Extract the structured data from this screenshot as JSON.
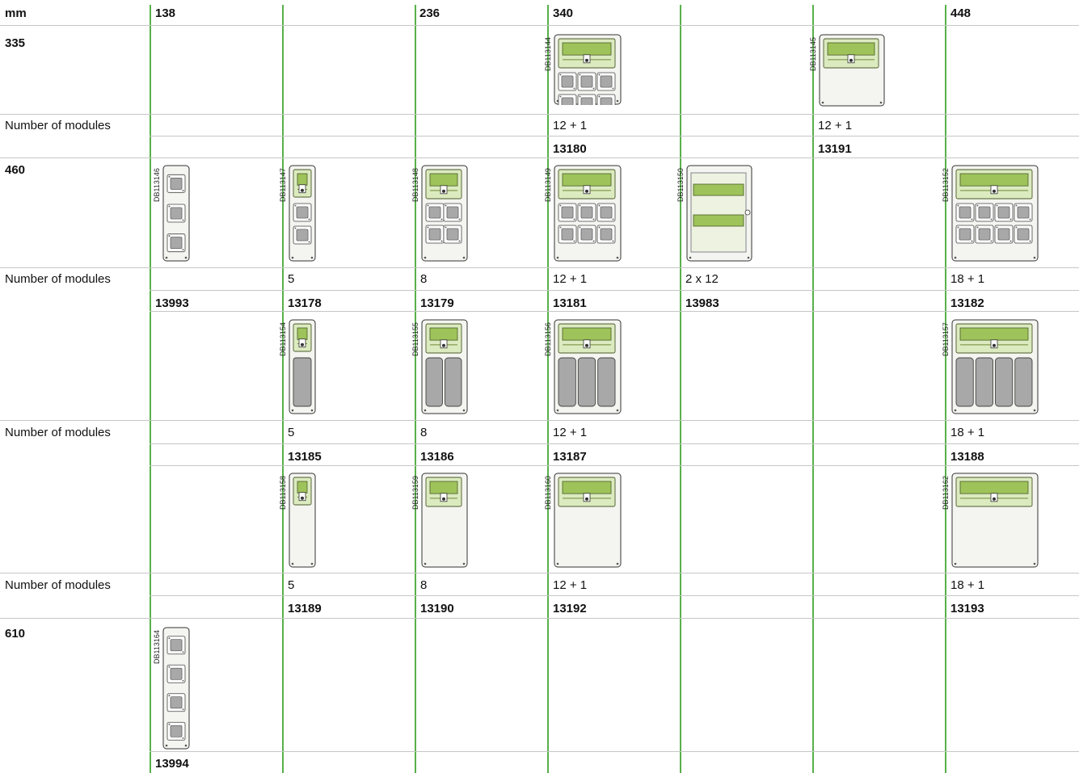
{
  "header": {
    "unit": "mm",
    "widths": [
      "138",
      "236",
      "340",
      "448"
    ]
  },
  "heights": [
    "335",
    "460",
    "610"
  ],
  "modules_label": "Number of modules",
  "blocks": [
    {
      "id": "h335-a",
      "images": [
        {
          "code": "DB113144",
          "col": 3,
          "type": "window-sockets",
          "rows": 2,
          "cols": 3
        },
        {
          "code": "DB113145",
          "col": 5,
          "type": "window",
          "sockets": 0
        }
      ],
      "modules": [
        "",
        "",
        "",
        "12 + 1",
        "",
        "12 + 1",
        ""
      ],
      "refs": [
        "",
        "",
        "",
        "13180",
        "",
        "13191",
        ""
      ]
    },
    {
      "id": "h460-a",
      "images": [
        {
          "code": "DB113146",
          "col": 0,
          "type": "sockets-only"
        },
        {
          "code": "DB113147",
          "col": 1,
          "type": "narrow-sockets"
        },
        {
          "code": "DB113148",
          "col": 2,
          "type": "window-sockets",
          "rows": 2,
          "cols": 2
        },
        {
          "code": "DB113149",
          "col": 3,
          "type": "window-sockets",
          "rows": 2,
          "cols": 3
        },
        {
          "code": "DB113150",
          "col": 4,
          "type": "double-window"
        },
        {
          "code": "DB113152",
          "col": 6,
          "type": "window-sockets",
          "rows": 2,
          "cols": 4
        }
      ],
      "modules": [
        "",
        "5",
        "8",
        "12 + 1",
        "2 x 12",
        "",
        "18 + 1"
      ],
      "refs": [
        "13993",
        "13178",
        "13179",
        "13181",
        "13983",
        "",
        "13182"
      ]
    },
    {
      "id": "h460-b",
      "images": [
        {
          "code": "DB113154",
          "col": 1,
          "type": "narrow-plates"
        },
        {
          "code": "DB113155",
          "col": 2,
          "type": "window-plates",
          "cols": 2
        },
        {
          "code": "DB113156",
          "col": 3,
          "type": "window-plates",
          "cols": 3
        },
        {
          "code": "DB113157",
          "col": 6,
          "type": "window-plates",
          "cols": 4
        }
      ],
      "modules": [
        "",
        "5",
        "8",
        "12 + 1",
        "",
        "",
        "18 + 1"
      ],
      "refs": [
        "",
        "13185",
        "13186",
        "13187",
        "",
        "",
        "13188"
      ]
    },
    {
      "id": "h460-c",
      "images": [
        {
          "code": "DB113158",
          "col": 1,
          "type": "narrow-blank"
        },
        {
          "code": "DB113159",
          "col": 2,
          "type": "window-blank",
          "cols": 2
        },
        {
          "code": "DB113160",
          "col": 3,
          "type": "window-blank",
          "cols": 3
        },
        {
          "code": "DB113162",
          "col": 6,
          "type": "window-blank",
          "cols": 4
        }
      ],
      "modules": [
        "",
        "5",
        "8",
        "12 + 1",
        "",
        "",
        "18 + 1"
      ],
      "refs": [
        "",
        "13189",
        "13190",
        "13192",
        "",
        "",
        "13193"
      ]
    },
    {
      "id": "h610",
      "images": [
        {
          "code": "DB113164",
          "col": 0,
          "type": "sockets-only-tall"
        }
      ],
      "refs": [
        "13994",
        "",
        "",
        "",
        "",
        "",
        ""
      ]
    }
  ],
  "colors": {
    "grid": "#58b04a",
    "rule": "#c6c6c6",
    "window": "#9ec35a",
    "window_light": "#dcebbf",
    "enclosure": "#f4f4f0",
    "socket": "#a8a8a8"
  }
}
